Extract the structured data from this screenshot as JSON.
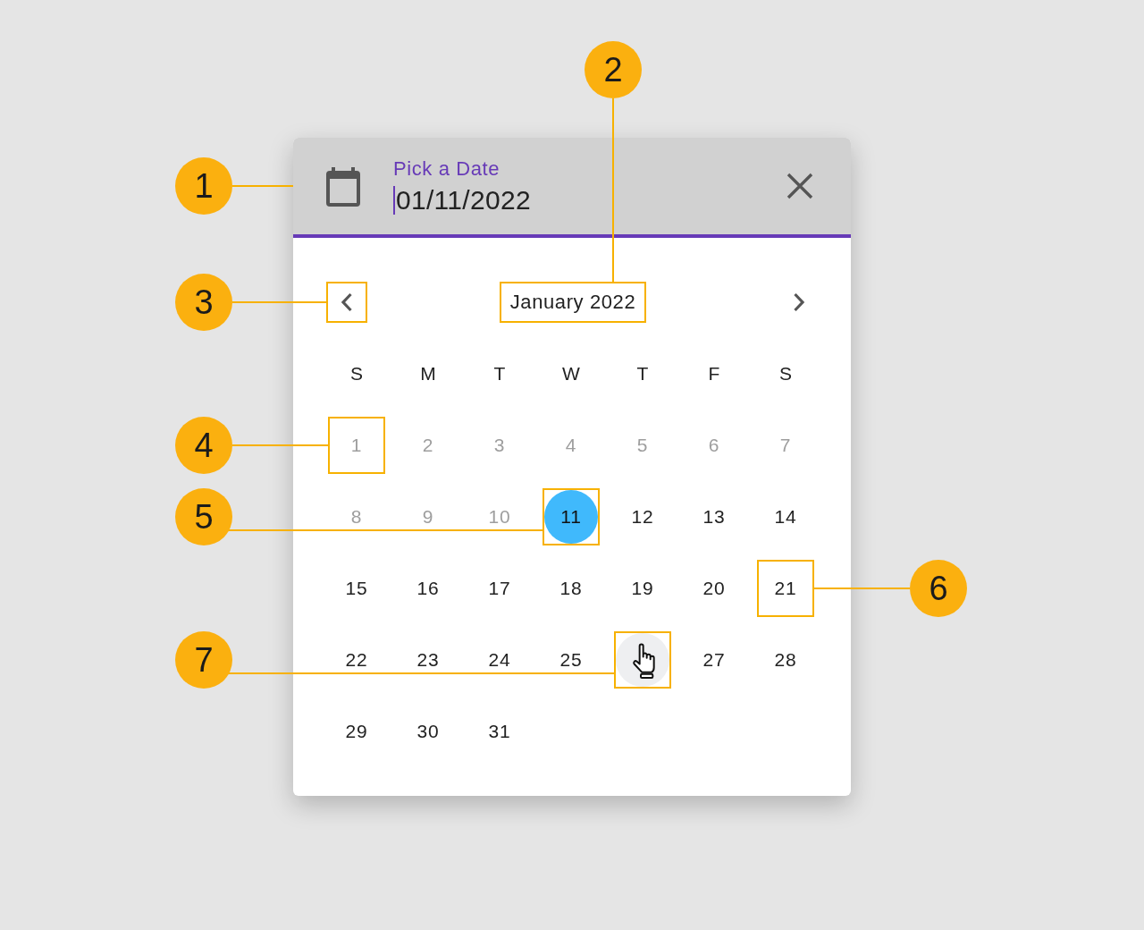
{
  "callouts": [
    {
      "number": "2",
      "kind": "month"
    },
    {
      "number": "1",
      "kind": "field"
    },
    {
      "number": "3",
      "kind": "prev"
    },
    {
      "number": "4",
      "kind": "day"
    },
    {
      "number": "5",
      "kind": "day"
    },
    {
      "number": "6",
      "kind": "day"
    },
    {
      "number": "7",
      "kind": "day"
    }
  ],
  "date_field": {
    "label": "Pick a Date",
    "value": "01/11/2022",
    "focused": true
  },
  "calendar": {
    "nav_buttons": [
      {
        "kind": "prev"
      },
      {
        "kind": "next"
      }
    ],
    "month": {
      "label": "January 2022"
    },
    "weekdays": [
      "S",
      "M",
      "T",
      "W",
      "T",
      "F",
      "S"
    ],
    "days": [
      {
        "label": "1",
        "disabled": true,
        "selected": false,
        "hovered": false,
        "highlighted": true
      },
      {
        "label": "2",
        "disabled": true,
        "selected": false,
        "hovered": false,
        "highlighted": false
      },
      {
        "label": "3",
        "disabled": true,
        "selected": false,
        "hovered": false,
        "highlighted": false
      },
      {
        "label": "4",
        "disabled": true,
        "selected": false,
        "hovered": false,
        "highlighted": false
      },
      {
        "label": "5",
        "disabled": true,
        "selected": false,
        "hovered": false,
        "highlighted": false
      },
      {
        "label": "6",
        "disabled": true,
        "selected": false,
        "hovered": false,
        "highlighted": false
      },
      {
        "label": "7",
        "disabled": true,
        "selected": false,
        "hovered": false,
        "highlighted": false
      },
      {
        "label": "8",
        "disabled": true,
        "selected": false,
        "hovered": false,
        "highlighted": false
      },
      {
        "label": "9",
        "disabled": true,
        "selected": false,
        "hovered": false,
        "highlighted": false
      },
      {
        "label": "10",
        "disabled": true,
        "selected": false,
        "hovered": false,
        "highlighted": false
      },
      {
        "label": "11",
        "disabled": false,
        "selected": true,
        "hovered": false,
        "highlighted": true
      },
      {
        "label": "12",
        "disabled": false,
        "selected": false,
        "hovered": false,
        "highlighted": false
      },
      {
        "label": "13",
        "disabled": false,
        "selected": false,
        "hovered": false,
        "highlighted": false
      },
      {
        "label": "14",
        "disabled": false,
        "selected": false,
        "hovered": false,
        "highlighted": false
      },
      {
        "label": "15",
        "disabled": false,
        "selected": false,
        "hovered": false,
        "highlighted": false
      },
      {
        "label": "16",
        "disabled": false,
        "selected": false,
        "hovered": false,
        "highlighted": false
      },
      {
        "label": "17",
        "disabled": false,
        "selected": false,
        "hovered": false,
        "highlighted": false
      },
      {
        "label": "18",
        "disabled": false,
        "selected": false,
        "hovered": false,
        "highlighted": false
      },
      {
        "label": "19",
        "disabled": false,
        "selected": false,
        "hovered": false,
        "highlighted": false
      },
      {
        "label": "20",
        "disabled": false,
        "selected": false,
        "hovered": false,
        "highlighted": false
      },
      {
        "label": "21",
        "disabled": false,
        "selected": false,
        "hovered": false,
        "highlighted": true
      },
      {
        "label": "22",
        "disabled": false,
        "selected": false,
        "hovered": false,
        "highlighted": false
      },
      {
        "label": "23",
        "disabled": false,
        "selected": false,
        "hovered": false,
        "highlighted": false
      },
      {
        "label": "24",
        "disabled": false,
        "selected": false,
        "hovered": false,
        "highlighted": false
      },
      {
        "label": "25",
        "disabled": false,
        "selected": false,
        "hovered": false,
        "highlighted": false
      },
      {
        "disabled": false,
        "selected": false,
        "hovered": true,
        "highlighted": true
      },
      {
        "label": "27",
        "disabled": false,
        "selected": false,
        "hovered": false,
        "highlighted": false
      },
      {
        "label": "28",
        "disabled": false,
        "selected": false,
        "hovered": false,
        "highlighted": false
      },
      {
        "label": "29",
        "disabled": false,
        "selected": false,
        "hovered": false,
        "highlighted": false
      },
      {
        "label": "30",
        "disabled": false,
        "selected": false,
        "hovered": false,
        "highlighted": false
      },
      {
        "label": "31",
        "disabled": false,
        "selected": false,
        "hovered": false,
        "highlighted": false
      }
    ]
  }
}
